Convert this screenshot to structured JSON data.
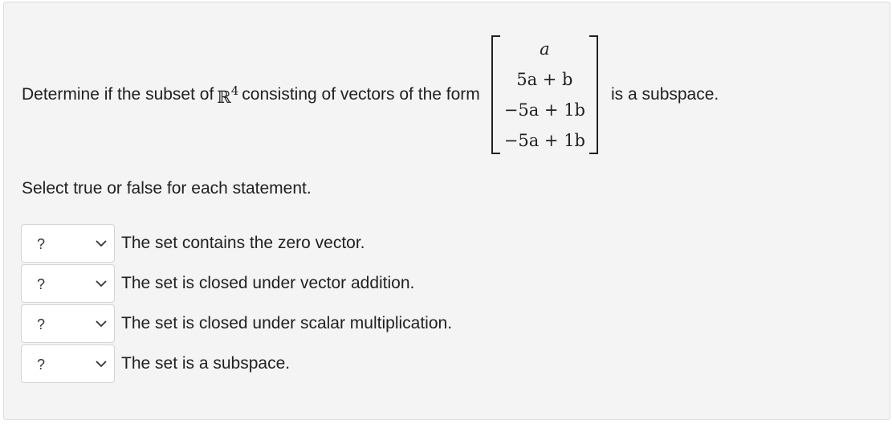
{
  "question": {
    "prefix": "Determine if the subset of",
    "space_symbol": "ℝ",
    "space_dim": "4",
    "middle": "consisting of vectors of the form",
    "suffix": "is a subspace.",
    "vector_rows": [
      {
        "text": "a"
      },
      {
        "text": "5a + b"
      },
      {
        "text": "−5a + 1b"
      },
      {
        "text": "−5a + 1b"
      }
    ]
  },
  "instructions": "Select true or false for each statement.",
  "statements": [
    {
      "select_value": "?",
      "text": "The set contains the zero vector."
    },
    {
      "select_value": "?",
      "text": "The set is closed under vector addition."
    },
    {
      "select_value": "?",
      "text": "The set is closed under scalar multiplication."
    },
    {
      "select_value": "?",
      "text": "The set is a subspace."
    }
  ],
  "icons": {
    "dropdown": "chevron-down-icon"
  },
  "colors": {
    "panel_bg": "#f4f4f4",
    "text": "#202124",
    "select_border": "#d3d3d3"
  }
}
